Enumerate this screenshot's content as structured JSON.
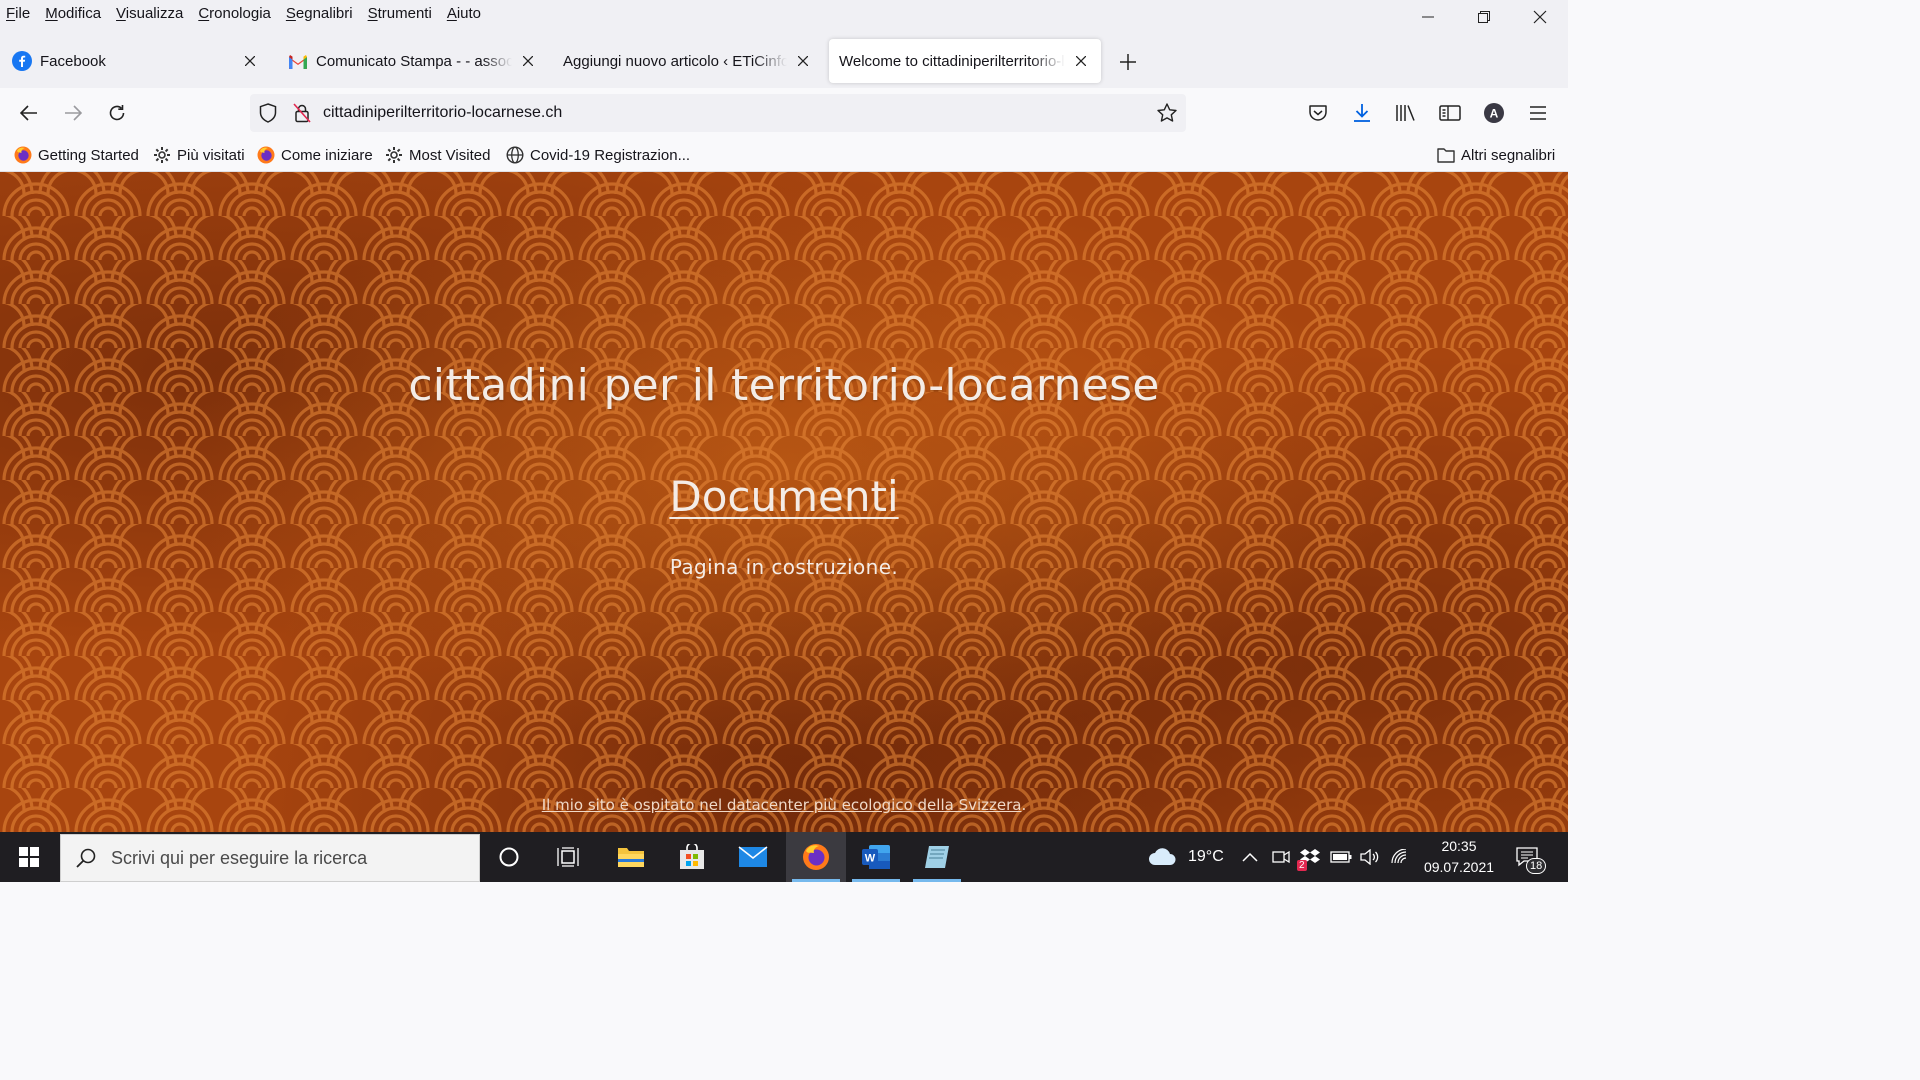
{
  "menubar": {
    "items": [
      "File",
      "Modifica",
      "Visualizza",
      "Cronologia",
      "Segnalibri",
      "Strumenti",
      "Aiuto"
    ]
  },
  "tabs": [
    {
      "title": "Facebook",
      "icon": "facebook-icon",
      "active": false
    },
    {
      "title": "Comunicato Stampa - - associaz",
      "icon": "gmail-icon",
      "active": false
    },
    {
      "title": "Aggiungi nuovo articolo ‹ ETiCinform",
      "icon": "",
      "active": false
    },
    {
      "title": "Welcome to cittadiniperilterritorio-lo",
      "icon": "",
      "active": true
    }
  ],
  "urlbar": {
    "url": "cittadiniperilterritorio-locarnese.ch"
  },
  "bookmarks": {
    "items": [
      {
        "label": "Getting Started",
        "icon": "firefox-icon"
      },
      {
        "label": "Più visitati",
        "icon": "gear-icon"
      },
      {
        "label": "Come iniziare",
        "icon": "firefox-icon"
      },
      {
        "label": "Most Visited",
        "icon": "gear-icon"
      },
      {
        "label": "Covid-19 Registrazion...",
        "icon": "globe-icon"
      }
    ],
    "other": "Altri segnalibri"
  },
  "page": {
    "title": "cittadini per il territorio-locarnese",
    "link": "Documenti",
    "note": "Pagina in costruzione.",
    "footer_link": "Il mio sito è ospitato nel datacenter più ecologico della Svizzera",
    "footer_end": "."
  },
  "taskbar": {
    "search_placeholder": "Scrivi qui per eseguire la ricerca",
    "weather": "19°C",
    "time": "20:35",
    "date": "09.07.2021",
    "notifications": "18",
    "badge": "2"
  },
  "colors": {
    "accent_download": "#0061e0",
    "taskbar": "#1f1e22",
    "page_bg": "#a8450f"
  }
}
